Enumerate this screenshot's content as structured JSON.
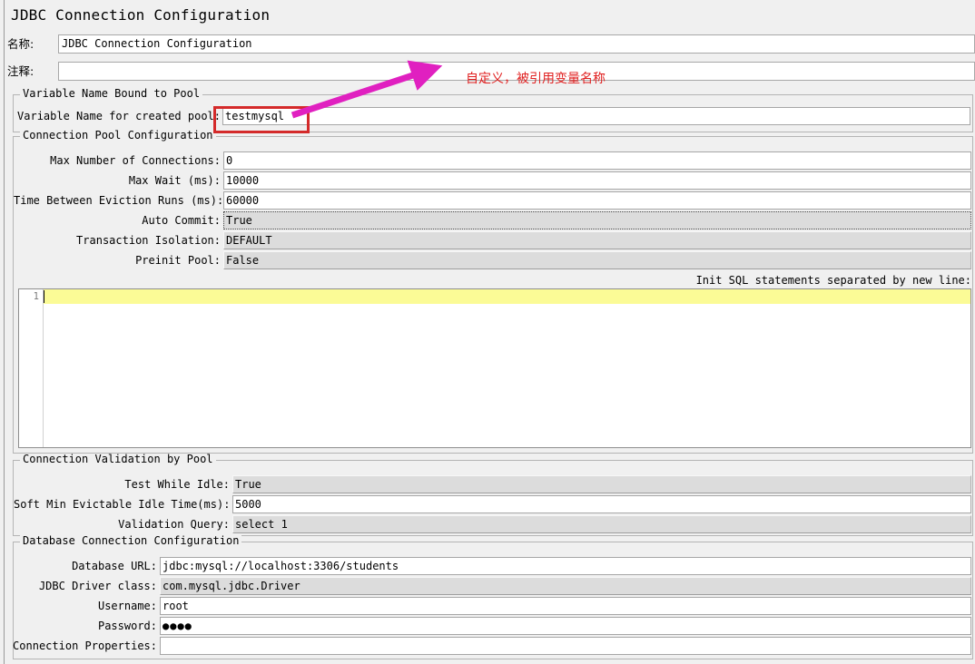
{
  "panel": {
    "title": "JDBC Connection Configuration"
  },
  "header": {
    "name_label": "名称:",
    "name_value": "JDBC Connection Configuration",
    "comment_label": "注释:",
    "comment_value": ""
  },
  "annotation": {
    "text": "自定义，被引用变量名称",
    "text_color": "#e02020",
    "box_color": "#d42a2a",
    "arrow_color": "#e020c0"
  },
  "variable_group": {
    "title": "Variable Name Bound to Pool",
    "rows": [
      {
        "label": "Variable Name for created pool:",
        "value": "testmysql",
        "type": "text"
      }
    ]
  },
  "pool_group": {
    "title": "Connection Pool Configuration",
    "rows": [
      {
        "label": "Max Number of Connections:",
        "value": "0",
        "type": "text"
      },
      {
        "label": "Max Wait (ms):",
        "value": "10000",
        "type": "text"
      },
      {
        "label": "Time Between Eviction Runs (ms):",
        "value": "60000",
        "type": "text"
      },
      {
        "label": "Auto Commit:",
        "value": "True",
        "type": "combo-focused"
      },
      {
        "label": "Transaction Isolation:",
        "value": "DEFAULT",
        "type": "combo"
      },
      {
        "label": "Preinit Pool:",
        "value": "False",
        "type": "combo"
      }
    ],
    "initsql_label": "Init SQL statements separated by new line:",
    "editor": {
      "line_number": "1",
      "content": ""
    }
  },
  "validation_group": {
    "title": "Connection Validation by Pool",
    "rows": [
      {
        "label": "Test While Idle:",
        "value": "True",
        "type": "combo"
      },
      {
        "label": "Soft Min Evictable Idle Time(ms):",
        "value": "5000",
        "type": "text"
      },
      {
        "label": "Validation Query:",
        "value": "select 1",
        "type": "combo"
      }
    ]
  },
  "database_group": {
    "title": "Database Connection Configuration",
    "rows": [
      {
        "label": "Database URL:",
        "value": "jdbc:mysql://localhost:3306/students",
        "type": "text"
      },
      {
        "label": "JDBC Driver class:",
        "value": "com.mysql.jdbc.Driver",
        "type": "combo"
      },
      {
        "label": "Username:",
        "value": "root",
        "type": "text"
      },
      {
        "label": "Password:",
        "value": "●●●●",
        "type": "password"
      },
      {
        "label": "Connection Properties:",
        "value": "",
        "type": "text"
      }
    ]
  }
}
